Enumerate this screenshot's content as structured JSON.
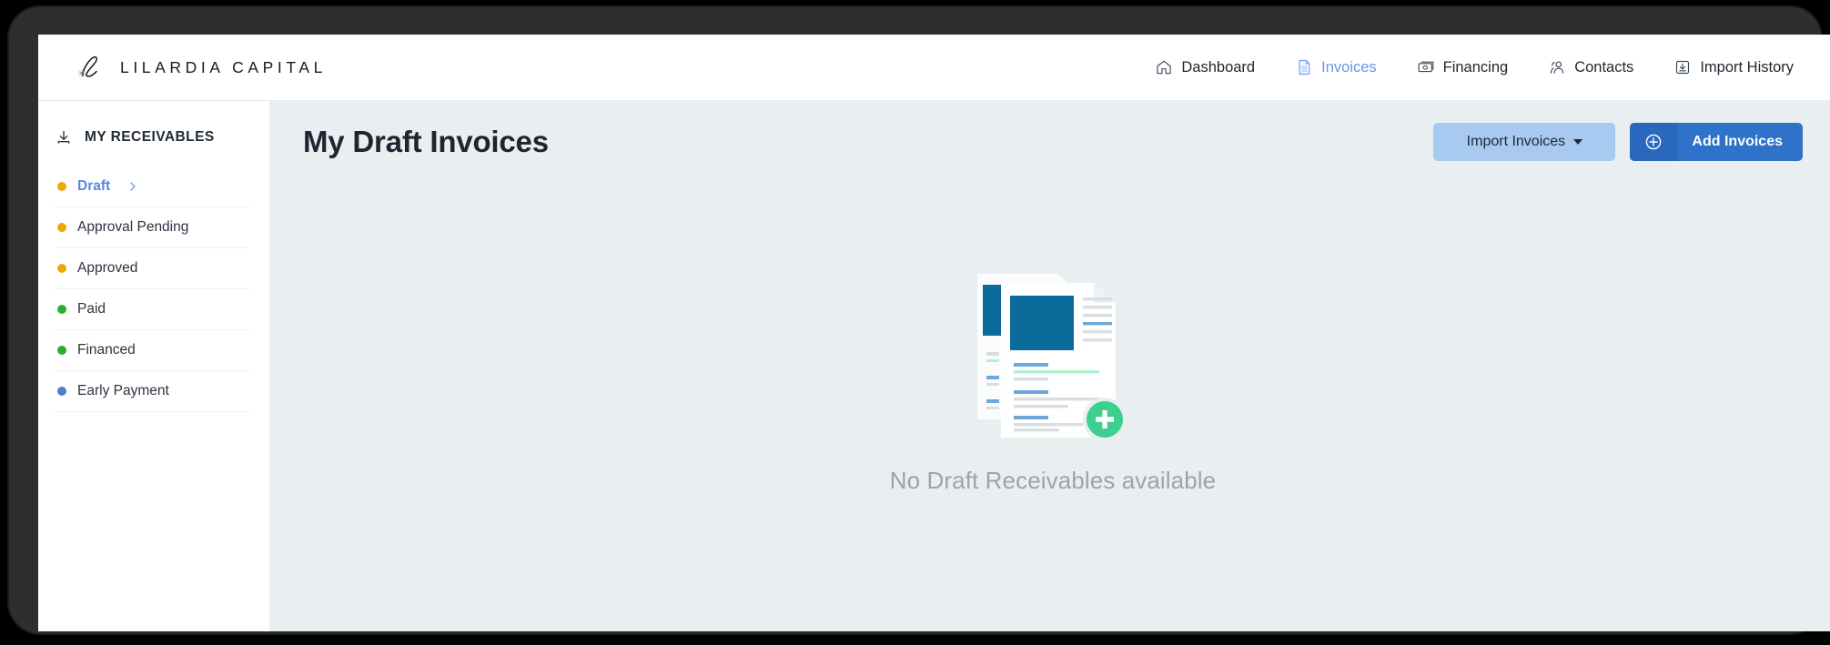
{
  "brand": {
    "name": "LILARDIA CAPITAL",
    "mark_icon": "script-l-logo-icon"
  },
  "top_nav": {
    "items": [
      {
        "label": "Dashboard",
        "icon": "home-icon",
        "active": false
      },
      {
        "label": "Invoices",
        "icon": "document-list-icon",
        "active": true
      },
      {
        "label": "Financing",
        "icon": "banknote-icon",
        "active": false
      },
      {
        "label": "Contacts",
        "icon": "people-icon",
        "active": false
      },
      {
        "label": "Import History",
        "icon": "import-download-icon",
        "active": false
      }
    ],
    "active_color": "#6b93e4",
    "inactive_color": "#222831"
  },
  "sidebar": {
    "header": {
      "label": "MY RECEIVABLES",
      "icon": "download-tray-icon"
    },
    "items": [
      {
        "label": "Draft",
        "dot_color": "#eda905",
        "active": true,
        "chevron_icon": "chevron-right-icon"
      },
      {
        "label": "Approval Pending",
        "dot_color": "#eda905",
        "active": false
      },
      {
        "label": "Approved",
        "dot_color": "#eda905",
        "active": false
      },
      {
        "label": "Paid",
        "dot_color": "#2eae2e",
        "active": false
      },
      {
        "label": "Financed",
        "dot_color": "#2eae2e",
        "active": false
      },
      {
        "label": "Early Payment",
        "dot_color": "#4a7fd4",
        "active": false
      }
    ]
  },
  "content": {
    "title": "My Draft Invoices",
    "background_color": "#e9eef1",
    "actions": {
      "import_label": "Import Invoices",
      "import_caret_icon": "caret-down-icon",
      "import_bg": "#a8c9f0",
      "add_label": "Add Invoices",
      "add_icon": "plus-circle-icon",
      "add_bg": "#2f72c9"
    },
    "empty_state": {
      "message": "No Draft Receivables available",
      "illustration_icon": "documents-stack-icon",
      "badge_icon": "plus-badge-icon",
      "badge_color": "#3ecf8e",
      "document_accent_color": "#0a6a99"
    }
  }
}
